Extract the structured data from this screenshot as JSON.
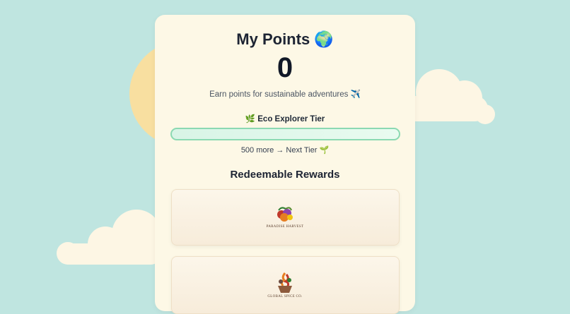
{
  "header": {
    "title": "My Points",
    "title_icon": "🌍",
    "points_value": "0",
    "subtitle": "Earn points for sustainable adventures",
    "subtitle_icon": "✈️"
  },
  "tier": {
    "icon": "🌿",
    "name": "Eco Explorer Tier",
    "progress_fraction": 0,
    "next_text": "500 more → Next Tier",
    "next_icon": "🌱"
  },
  "rewards": {
    "heading": "Redeemable Rewards",
    "items": [
      {
        "logo_name": "PARADISE HARVEST"
      },
      {
        "logo_name": "GLOBAL SPICE CO."
      }
    ]
  },
  "colors": {
    "background": "#bfe5e0",
    "card": "#fdf8e6",
    "progress_border": "#8bd9b2"
  }
}
